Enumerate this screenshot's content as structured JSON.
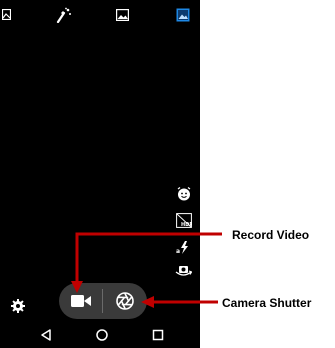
{
  "annotations": {
    "record_video": "Record Video",
    "camera_shutter": "Camera Shutter"
  },
  "colors": {
    "annotation_arrow": "#c00000",
    "capsule_bg": "#3a3a3a",
    "scene_icon_accent": "#1e88e5",
    "screen_bg": "#000000"
  },
  "icons": {
    "top_bar": [
      "mode-icon",
      "effect-icon",
      "gallery-icon",
      "scene-mode-icon"
    ],
    "right_column": [
      "face-detect-icon",
      "hdr-icon",
      "flash-auto-icon",
      "camera-switch-icon"
    ],
    "bottom": [
      "settings-icon",
      "video-camera-icon",
      "shutter-icon"
    ],
    "nav": [
      "back-icon",
      "home-icon",
      "recent-apps-icon"
    ]
  }
}
